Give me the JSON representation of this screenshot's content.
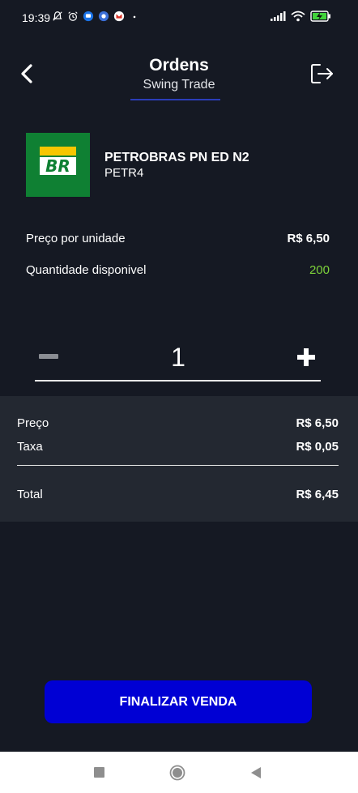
{
  "status_bar": {
    "time": "19:39",
    "left_icons": [
      "bell-off-icon",
      "alarm-icon",
      "messages-icon",
      "app-icon",
      "gmail-icon",
      "dot-icon"
    ],
    "right_icons": [
      "signal-icon",
      "wifi-icon",
      "battery-charging-icon"
    ]
  },
  "header": {
    "title": "Ordens",
    "subtitle": "Swing Trade",
    "back_icon": "chevron-left-icon",
    "logout_icon": "logout-icon",
    "underline_color": "#2b3db8"
  },
  "asset": {
    "name": "PETROBRAS PN ED N2",
    "ticker": "PETR4",
    "logo_text": "BR",
    "logo_colors": {
      "background": "#0f8033",
      "yellow": "#f7c600",
      "white": "#ffffff"
    }
  },
  "info": {
    "unit_price_label": "Preço por unidade",
    "unit_price_value": "R$ 6,50",
    "available_label": "Quantidade disponivel",
    "available_value": "200",
    "available_color": "#7dd23a"
  },
  "stepper": {
    "quantity": "1",
    "minus_icon": "minus-icon",
    "plus_icon": "plus-icon"
  },
  "summary": {
    "price_label": "Preço",
    "price_value": "R$ 6,50",
    "fee_label": "Taxa",
    "fee_value": "R$ 0,05",
    "total_label": "Total",
    "total_value": "R$ 6,45"
  },
  "cta": {
    "label": "FINALIZAR VENDA",
    "color": "#0000d4"
  },
  "nav": {
    "icons": [
      "recent-apps-icon",
      "home-icon",
      "back-icon"
    ]
  }
}
